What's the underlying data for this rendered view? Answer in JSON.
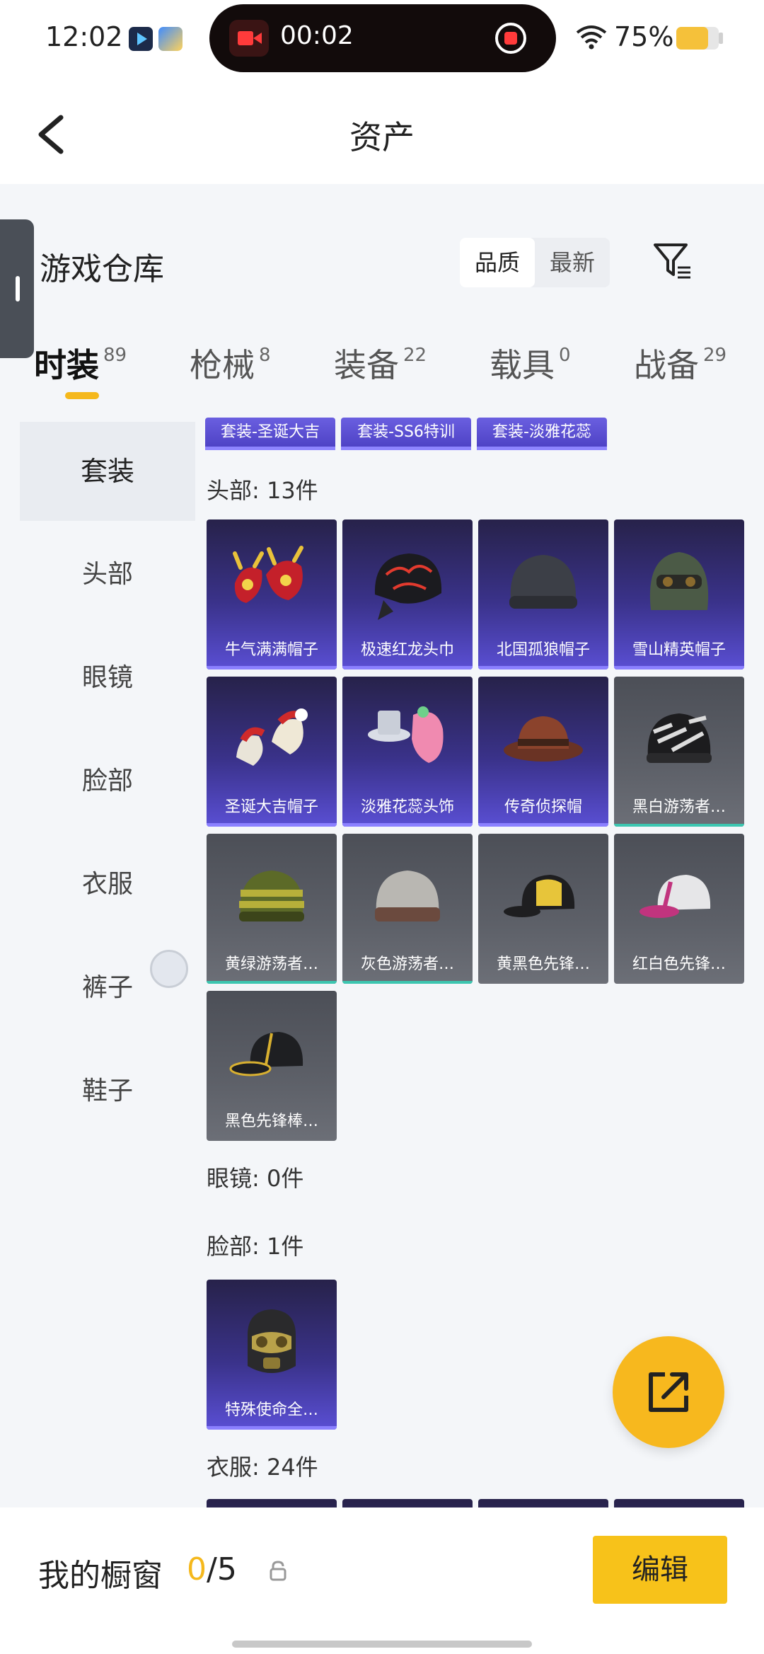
{
  "status": {
    "time": "12:02",
    "recording_time": "00:02",
    "battery": "75%",
    "battery_level": 0.75
  },
  "header": {
    "title": "资产"
  },
  "warehouse": {
    "title": "游戏仓库",
    "sort_options": [
      "品质",
      "最新"
    ]
  },
  "tabs": [
    {
      "label": "时装",
      "count": "89"
    },
    {
      "label": "枪械",
      "count": "8"
    },
    {
      "label": "装备",
      "count": "22"
    },
    {
      "label": "载具",
      "count": "0"
    },
    {
      "label": "战备",
      "count": "29"
    }
  ],
  "nav": [
    "套装",
    "头部",
    "眼镜",
    "脸部",
    "衣服",
    "裤子",
    "鞋子"
  ],
  "set_tags": [
    "套装-圣诞大吉",
    "套装-SS6特训",
    "套装-淡雅花蕊"
  ],
  "sections": {
    "head": "头部: 13件",
    "glasses": "眼镜: 0件",
    "face": "脸部: 1件",
    "clothes": "衣服: 24件"
  },
  "head_items": [
    {
      "name": "牛气满满帽子",
      "icon": "ox-hat-icon"
    },
    {
      "name": "极速红龙头巾",
      "icon": "dragon-bandana-icon"
    },
    {
      "name": "北国孤狼帽子",
      "icon": "wolf-beanie-icon"
    },
    {
      "name": "雪山精英帽子",
      "icon": "snow-elite-hat-icon"
    },
    {
      "name": "圣诞大吉帽子",
      "icon": "christmas-hat-icon"
    },
    {
      "name": "淡雅花蕊头饰",
      "icon": "flower-headwear-icon"
    },
    {
      "name": "传奇侦探帽",
      "icon": "detective-hat-icon"
    },
    {
      "name": "黑白游荡者…",
      "icon": "zebra-beanie-icon"
    },
    {
      "name": "黄绿游荡者…",
      "icon": "striped-beanie-icon"
    },
    {
      "name": "灰色游荡者…",
      "icon": "grey-beanie-icon"
    },
    {
      "name": "黄黑色先锋…",
      "icon": "yellow-cap-icon"
    },
    {
      "name": "红白色先锋…",
      "icon": "pink-cap-icon"
    },
    {
      "name": "黑色先锋棒…",
      "icon": "black-cap-icon"
    }
  ],
  "face_items": [
    {
      "name": "特殊使命全…",
      "icon": "gas-mask-icon"
    }
  ],
  "bottom": {
    "window_label": "我的橱窗",
    "window_current": "0",
    "window_total": "/5",
    "edit_label": "编辑"
  },
  "colors": {
    "accent": "#f7c21a",
    "purple_card": "#4b3fc2",
    "grey_card": "#5d6068"
  }
}
